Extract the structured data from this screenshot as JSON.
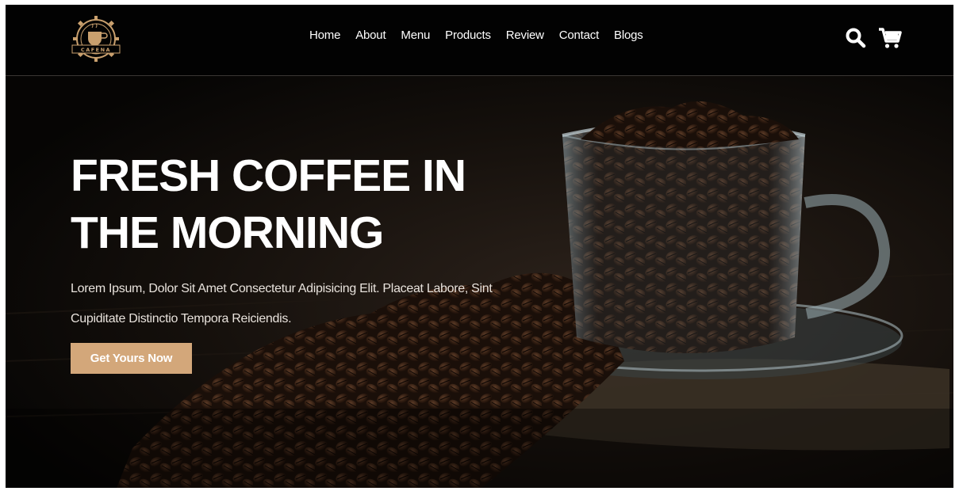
{
  "brand": {
    "logo_text": "CAFENA"
  },
  "nav": {
    "items": [
      {
        "label": "Home"
      },
      {
        "label": "About"
      },
      {
        "label": "Menu"
      },
      {
        "label": "Products"
      },
      {
        "label": "Review"
      },
      {
        "label": "Contact"
      },
      {
        "label": "Blogs"
      }
    ]
  },
  "header_icons": [
    "search-icon",
    "cart-icon"
  ],
  "hero": {
    "headline_line1": "FRESH COFFEE IN",
    "headline_line2": "THE MORNING",
    "subtext": "Lorem Ipsum, Dolor Sit Amet Consectetur Adipisicing Elit. Placeat Labore, Sint Cupiditate Distinctio Tempora Reiciendis.",
    "cta_label": "Get Yours Now"
  },
  "colors": {
    "accent": "#d3a77a",
    "header_bg": "#020202",
    "hero_bg": "#0b0806",
    "text": "#ffffff"
  }
}
